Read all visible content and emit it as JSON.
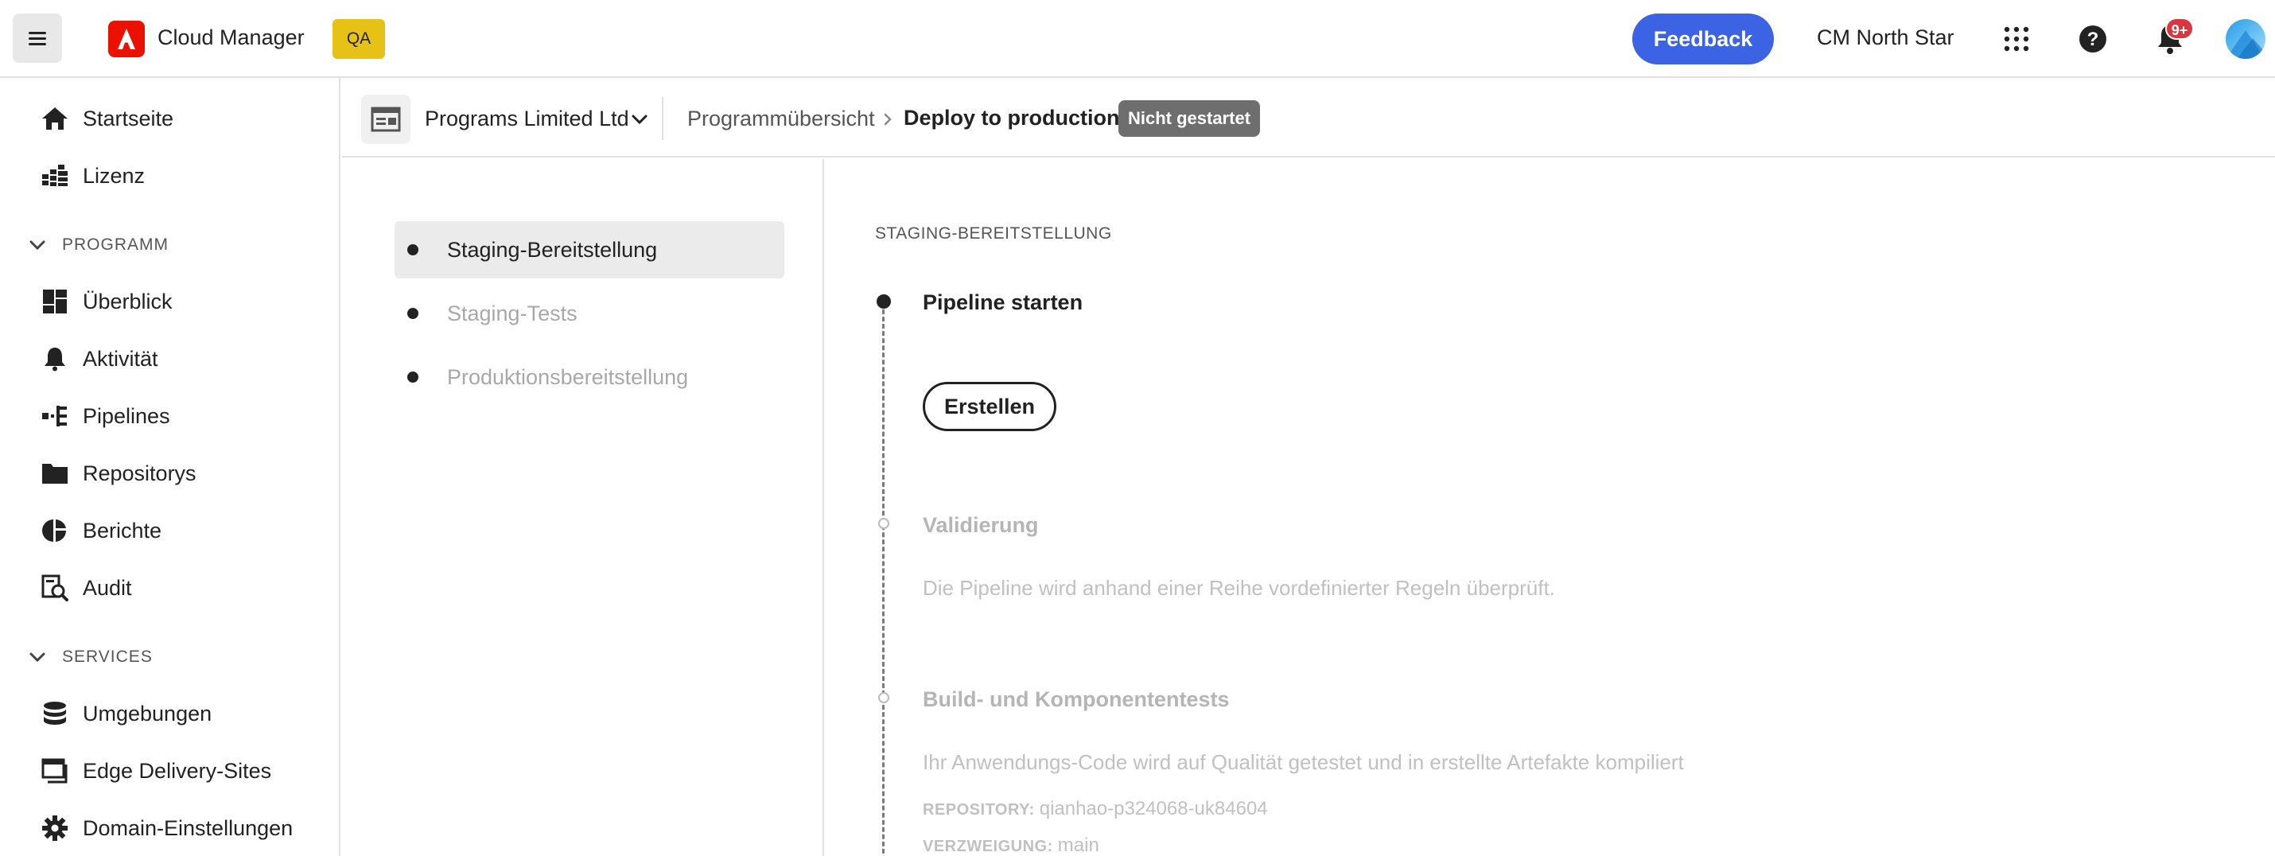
{
  "header": {
    "menu_icon": "hamburger-icon",
    "logo_icon": "adobe-logo-icon",
    "app_title": "Cloud Manager",
    "env_badge": "QA",
    "feedback_label": "Feedback",
    "org_name": "CM North Star",
    "apps_icon": "app-grid-icon",
    "help_icon": "help-icon",
    "bell_icon": "bell-icon",
    "notification_count": "9+",
    "brand_color": "#eb1000",
    "feedback_color": "#3b63e3"
  },
  "sidebar": {
    "top_items": [
      {
        "label": "Startseite",
        "icon": "home-icon"
      },
      {
        "label": "Lizenz",
        "icon": "license-icon"
      }
    ],
    "section_program": {
      "label": "PROGRAMM",
      "items": [
        {
          "label": "Überblick",
          "icon": "overview-icon"
        },
        {
          "label": "Aktivität",
          "icon": "bell-icon"
        },
        {
          "label": "Pipelines",
          "icon": "pipeline-icon"
        },
        {
          "label": "Repositorys",
          "icon": "folder-icon"
        },
        {
          "label": "Berichte",
          "icon": "report-icon"
        },
        {
          "label": "Audit",
          "icon": "audit-icon"
        }
      ]
    },
    "section_services": {
      "label": "SERVICES",
      "items": [
        {
          "label": "Umgebungen",
          "icon": "database-icon"
        },
        {
          "label": "Edge Delivery-Sites",
          "icon": "window-icon"
        },
        {
          "label": "Domain-Einstellungen",
          "icon": "gear-icon"
        }
      ]
    }
  },
  "breadcrumb": {
    "program_name": "Programs Limited Ltd",
    "crumb1": "Programmübersicht",
    "current": "Deploy to production",
    "status": "Nicht gestartet"
  },
  "steps": [
    {
      "label": "Staging-Bereitstellung",
      "active": true
    },
    {
      "label": "Staging-Tests",
      "active": false
    },
    {
      "label": "Produktionsbereitstellung",
      "active": false
    }
  ],
  "detail": {
    "section_title": "STAGING-BEREITSTELLUNG",
    "stages": [
      {
        "title": "Pipeline starten",
        "button": "Erstellen"
      },
      {
        "title": "Validierung",
        "desc": "Die Pipeline wird anhand einer Reihe vordefinierter Regeln überprüft."
      },
      {
        "title": "Build- und Komponententests",
        "desc": "Ihr Anwendungs-Code wird auf Qualität getestet und in erstellte Artefakte kompiliert",
        "repository_key": "REPOSITORY:",
        "repository_val": "qianhao-p324068-uk84604",
        "branch_key": "VERZWEIGUNG:",
        "branch_val": "main"
      }
    ]
  }
}
